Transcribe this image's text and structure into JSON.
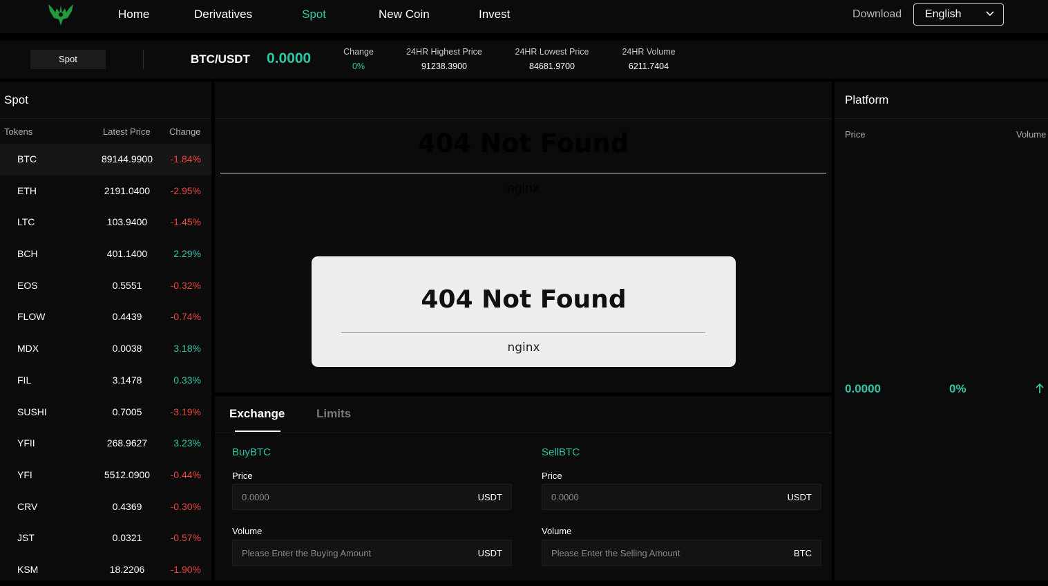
{
  "nav": {
    "items": [
      "Home",
      "Derivatives",
      "Spot",
      "New Coin",
      "Invest"
    ],
    "active": "Spot",
    "download": "Download",
    "language": "English"
  },
  "ticker": {
    "spot_button": "Spot",
    "pair": "BTC/USDT",
    "last_price": "0.0000",
    "change_label": "Change",
    "change_value": "0%",
    "high_label": "24HR Highest Price",
    "high_value": "91238.3900",
    "low_label": "24HR Lowest Price",
    "low_value": "84681.9700",
    "volume_label": "24HR Volume",
    "volume_value": "6211.7404"
  },
  "market": {
    "title": "Spot",
    "columns": [
      "Tokens",
      "Latest Price",
      "Change"
    ],
    "rows": [
      {
        "token": "BTC",
        "price": "89144.9900",
        "change": "-1.84%",
        "dir": "down"
      },
      {
        "token": "ETH",
        "price": "2191.0400",
        "change": "-2.95%",
        "dir": "down"
      },
      {
        "token": "LTC",
        "price": "103.9400",
        "change": "-1.45%",
        "dir": "down"
      },
      {
        "token": "BCH",
        "price": "401.1400",
        "change": "2.29%",
        "dir": "up"
      },
      {
        "token": "EOS",
        "price": "0.5551",
        "change": "-0.32%",
        "dir": "down"
      },
      {
        "token": "FLOW",
        "price": "0.4439",
        "change": "-0.74%",
        "dir": "down"
      },
      {
        "token": "MDX",
        "price": "0.0038",
        "change": "3.18%",
        "dir": "up"
      },
      {
        "token": "FIL",
        "price": "3.1478",
        "change": "0.33%",
        "dir": "up"
      },
      {
        "token": "SUSHI",
        "price": "0.7005",
        "change": "-3.19%",
        "dir": "down"
      },
      {
        "token": "YFII",
        "price": "268.9627",
        "change": "3.23%",
        "dir": "up"
      },
      {
        "token": "YFI",
        "price": "5512.0900",
        "change": "-0.44%",
        "dir": "down"
      },
      {
        "token": "CRV",
        "price": "0.4369",
        "change": "-0.30%",
        "dir": "down"
      },
      {
        "token": "JST",
        "price": "0.0321",
        "change": "-0.57%",
        "dir": "down"
      },
      {
        "token": "KSM",
        "price": "18.2206",
        "change": "-1.90%",
        "dir": "down"
      }
    ]
  },
  "chart_error": {
    "title": "404 Not Found",
    "subtitle": "nginx"
  },
  "trade": {
    "tabs": [
      "Exchange",
      "Limits"
    ],
    "buy_title": "BuyBTC",
    "sell_title": "SellBTC",
    "price_label": "Price",
    "volume_label": "Volume",
    "buy_price_placeholder": "0.0000",
    "sell_price_placeholder": "0.0000",
    "price_unit": "USDT",
    "buy_volume_placeholder": "Please Enter the Buying Amount",
    "buy_volume_unit": "USDT",
    "sell_volume_placeholder": "Please Enter the Selling Amount",
    "sell_volume_unit": "BTC"
  },
  "platform": {
    "title": "Platform",
    "price_header": "Price",
    "volume_header": "Volume",
    "price": "0.0000",
    "change": "0%"
  },
  "colors": {
    "accent": "#2fc6a6",
    "down": "#e8463c",
    "panel": "#0b0b0b",
    "background": "#000000"
  },
  "icons": [
    "phoenix-logo-icon",
    "chevron-down-icon",
    "arrow-up-icon"
  ]
}
